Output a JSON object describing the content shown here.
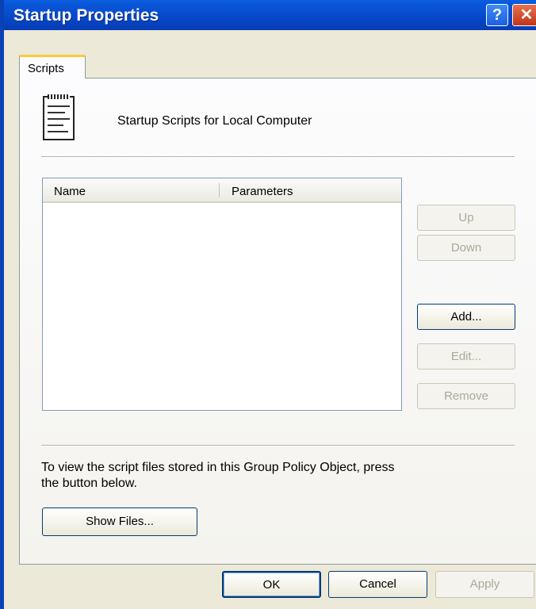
{
  "window": {
    "title": "Startup Properties"
  },
  "titlebar": {
    "help_label": "?",
    "close_label": "✕"
  },
  "tabs": [
    {
      "label": "Scripts"
    }
  ],
  "header": {
    "text": "Startup Scripts for Local Computer",
    "icon": "script-icon"
  },
  "list": {
    "columns": [
      "Name",
      "Parameters"
    ],
    "rows": []
  },
  "side_buttons": {
    "up": "Up",
    "down": "Down",
    "add": "Add...",
    "edit": "Edit...",
    "remove": "Remove"
  },
  "info": {
    "line1": "To view the script files stored in this Group Policy Object, press",
    "line2": "the button below."
  },
  "show_files_label": "Show Files...",
  "dialog_buttons": {
    "ok": "OK",
    "cancel": "Cancel",
    "apply": "Apply"
  },
  "colors": {
    "titlebar": "#0a56d8",
    "dialog_bg": "#ece9d8",
    "tab_highlight": "#ffc83c"
  }
}
